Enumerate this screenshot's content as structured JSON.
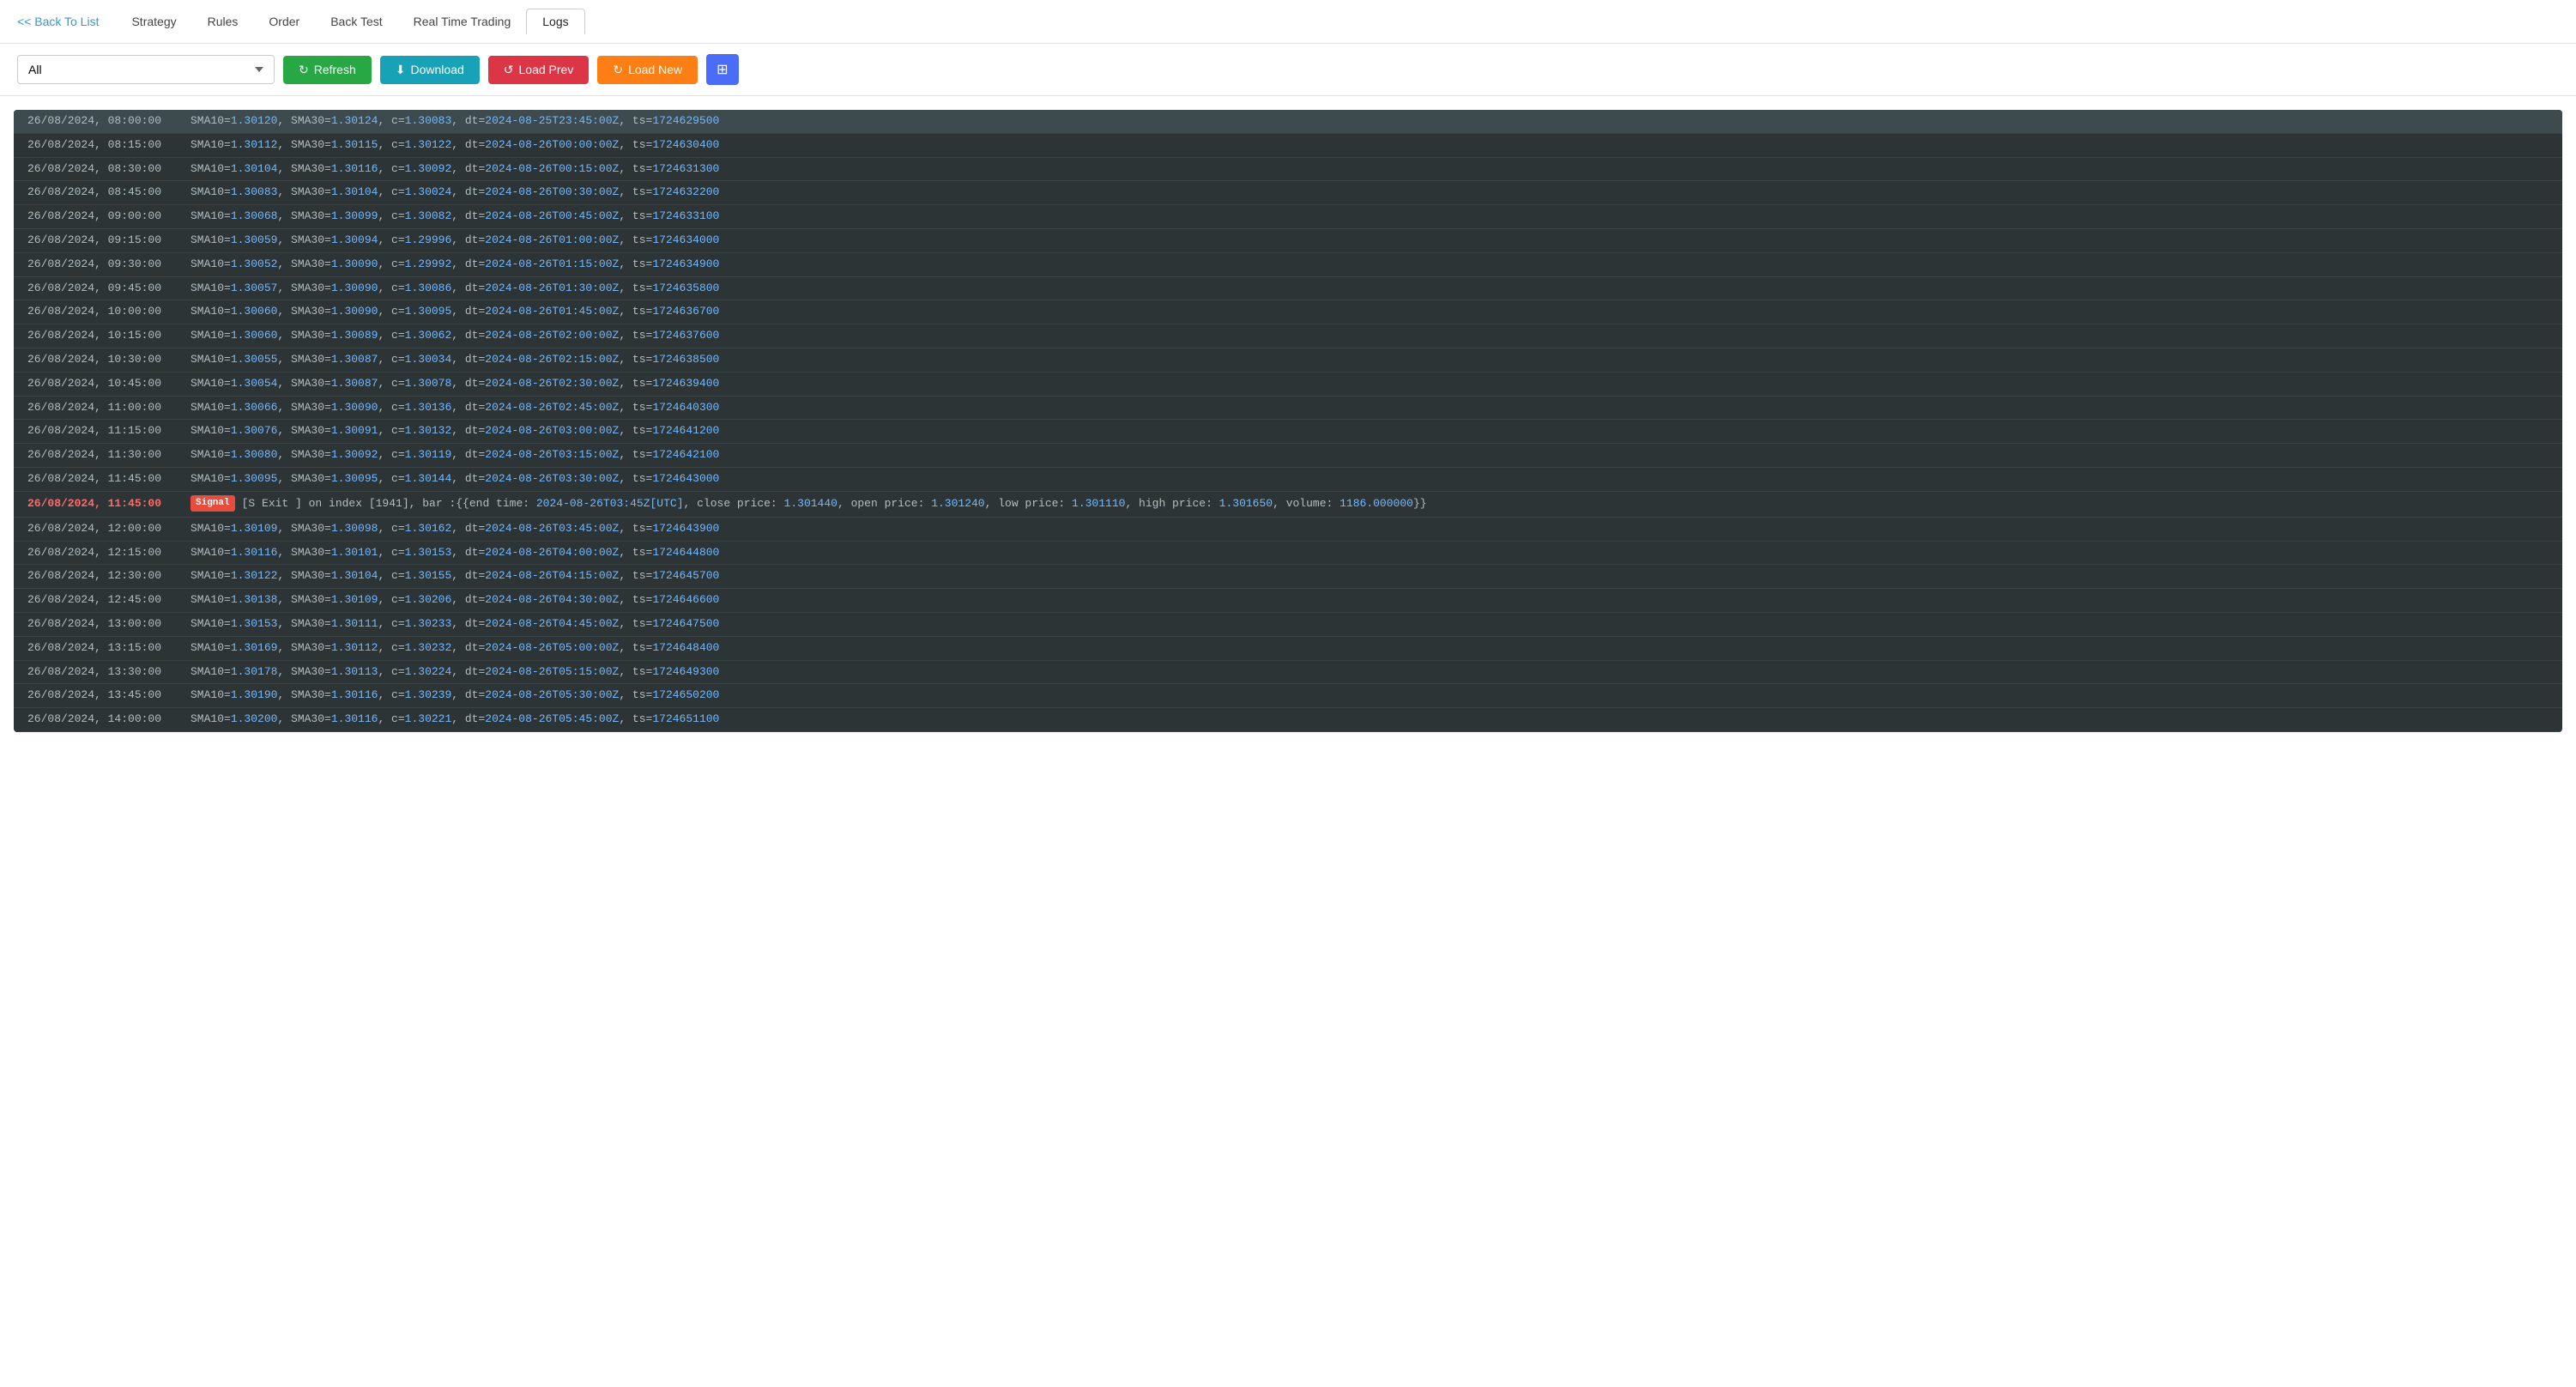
{
  "nav": {
    "back_label": "<< Back To List",
    "items": [
      {
        "label": "Strategy",
        "active": false
      },
      {
        "label": "Rules",
        "active": false
      },
      {
        "label": "Order",
        "active": false
      },
      {
        "label": "Back Test",
        "active": false
      },
      {
        "label": "Real Time Trading",
        "active": false
      },
      {
        "label": "Logs",
        "active": true
      }
    ]
  },
  "toolbar": {
    "filter_value": "All",
    "filter_options": [
      "All"
    ],
    "refresh_label": "Refresh",
    "download_label": "Download",
    "load_prev_label": "Load Prev",
    "load_new_label": "Load New"
  },
  "logs": [
    {
      "time": "26/08/2024, 08:00:00",
      "content": "SMA10=1.30120, SMA30=1.30124, c=1.30083, dt=2024-08-25T23:45:00Z, ts=1724629500",
      "highlight": true,
      "signal": false
    },
    {
      "time": "26/08/2024, 08:15:00",
      "content": "SMA10=1.30112, SMA30=1.30115, c=1.30122, dt=2024-08-26T00:00:00Z, ts=1724630400",
      "highlight": false,
      "signal": false
    },
    {
      "time": "26/08/2024, 08:30:00",
      "content": "SMA10=1.30104, SMA30=1.30116, c=1.30092, dt=2024-08-26T00:15:00Z, ts=1724631300",
      "highlight": false,
      "signal": false
    },
    {
      "time": "26/08/2024, 08:45:00",
      "content": "SMA10=1.30083, SMA30=1.30104, c=1.30024, dt=2024-08-26T00:30:00Z, ts=1724632200",
      "highlight": false,
      "signal": false
    },
    {
      "time": "26/08/2024, 09:00:00",
      "content": "SMA10=1.30068, SMA30=1.30099, c=1.30082, dt=2024-08-26T00:45:00Z, ts=1724633100",
      "highlight": false,
      "signal": false
    },
    {
      "time": "26/08/2024, 09:15:00",
      "content": "SMA10=1.30059, SMA30=1.30094, c=1.29996, dt=2024-08-26T01:00:00Z, ts=1724634000",
      "highlight": false,
      "signal": false
    },
    {
      "time": "26/08/2024, 09:30:00",
      "content": "SMA10=1.30052, SMA30=1.30090, c=1.29992, dt=2024-08-26T01:15:00Z, ts=1724634900",
      "highlight": false,
      "signal": false
    },
    {
      "time": "26/08/2024, 09:45:00",
      "content": "SMA10=1.30057, SMA30=1.30090, c=1.30086, dt=2024-08-26T01:30:00Z, ts=1724635800",
      "highlight": false,
      "signal": false
    },
    {
      "time": "26/08/2024, 10:00:00",
      "content": "SMA10=1.30060, SMA30=1.30090, c=1.30095, dt=2024-08-26T01:45:00Z, ts=1724636700",
      "highlight": false,
      "signal": false
    },
    {
      "time": "26/08/2024, 10:15:00",
      "content": "SMA10=1.30060, SMA30=1.30089, c=1.30062, dt=2024-08-26T02:00:00Z, ts=1724637600",
      "highlight": false,
      "signal": false
    },
    {
      "time": "26/08/2024, 10:30:00",
      "content": "SMA10=1.30055, SMA30=1.30087, c=1.30034, dt=2024-08-26T02:15:00Z, ts=1724638500",
      "highlight": false,
      "signal": false
    },
    {
      "time": "26/08/2024, 10:45:00",
      "content": "SMA10=1.30054, SMA30=1.30087, c=1.30078, dt=2024-08-26T02:30:00Z, ts=1724639400",
      "highlight": false,
      "signal": false
    },
    {
      "time": "26/08/2024, 11:00:00",
      "content": "SMA10=1.30066, SMA30=1.30090, c=1.30136, dt=2024-08-26T02:45:00Z, ts=1724640300",
      "highlight": false,
      "signal": false
    },
    {
      "time": "26/08/2024, 11:15:00",
      "content": "SMA10=1.30076, SMA30=1.30091, c=1.30132, dt=2024-08-26T03:00:00Z, ts=1724641200",
      "highlight": false,
      "signal": false
    },
    {
      "time": "26/08/2024, 11:30:00",
      "content": "SMA10=1.30080, SMA30=1.30092, c=1.30119, dt=2024-08-26T03:15:00Z, ts=1724642100",
      "highlight": false,
      "signal": false
    },
    {
      "time": "26/08/2024, 11:45:00",
      "content": "SMA10=1.30095, SMA30=1.30095, c=1.30144, dt=2024-08-26T03:30:00Z, ts=1724643000",
      "highlight": false,
      "signal": false
    },
    {
      "time": "26/08/2024, 11:45:00",
      "content": "[S Exit ] on index [1941], bar :{{end time: 2024-08-26T03:45Z[UTC], close price: 1.301440, open price: 1.301240, low price: 1.301110, high price: 1.301650, volume: 1186.000000}}",
      "highlight": false,
      "signal": true
    },
    {
      "time": "26/08/2024, 12:00:00",
      "content": "SMA10=1.30109, SMA30=1.30098, c=1.30162, dt=2024-08-26T03:45:00Z, ts=1724643900",
      "highlight": false,
      "signal": false
    },
    {
      "time": "26/08/2024, 12:15:00",
      "content": "SMA10=1.30116, SMA30=1.30101, c=1.30153, dt=2024-08-26T04:00:00Z, ts=1724644800",
      "highlight": false,
      "signal": false
    },
    {
      "time": "26/08/2024, 12:30:00",
      "content": "SMA10=1.30122, SMA30=1.30104, c=1.30155, dt=2024-08-26T04:15:00Z, ts=1724645700",
      "highlight": false,
      "signal": false
    },
    {
      "time": "26/08/2024, 12:45:00",
      "content": "SMA10=1.30138, SMA30=1.30109, c=1.30206, dt=2024-08-26T04:30:00Z, ts=1724646600",
      "highlight": false,
      "signal": false
    },
    {
      "time": "26/08/2024, 13:00:00",
      "content": "SMA10=1.30153, SMA30=1.30111, c=1.30233, dt=2024-08-26T04:45:00Z, ts=1724647500",
      "highlight": false,
      "signal": false
    },
    {
      "time": "26/08/2024, 13:15:00",
      "content": "SMA10=1.30169, SMA30=1.30112, c=1.30232, dt=2024-08-26T05:00:00Z, ts=1724648400",
      "highlight": false,
      "signal": false
    },
    {
      "time": "26/08/2024, 13:30:00",
      "content": "SMA10=1.30178, SMA30=1.30113, c=1.30224, dt=2024-08-26T05:15:00Z, ts=1724649300",
      "highlight": false,
      "signal": false
    },
    {
      "time": "26/08/2024, 13:45:00",
      "content": "SMA10=1.30190, SMA30=1.30116, c=1.30239, dt=2024-08-26T05:30:00Z, ts=1724650200",
      "highlight": false,
      "signal": false
    },
    {
      "time": "26/08/2024, 14:00:00",
      "content": "SMA10=1.30200, SMA30=1.30116, c=1.30221, dt=2024-08-26T05:45:00Z, ts=1724651100",
      "highlight": false,
      "signal": false
    }
  ]
}
